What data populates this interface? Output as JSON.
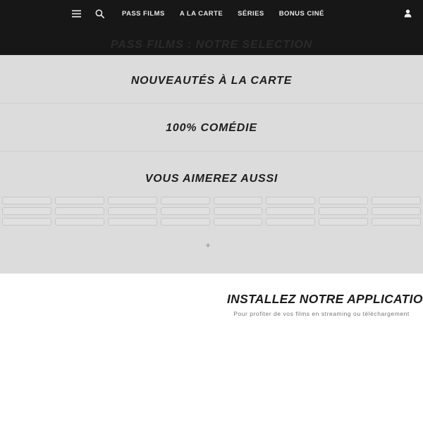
{
  "header": {
    "nav": {
      "menu_icon": "hamburger-menu-icon",
      "search_icon": "search-icon",
      "account_icon": "user-account-icon",
      "links": [
        {
          "label": "PASS FILMS"
        },
        {
          "label": "A LA CARTE"
        },
        {
          "label": "SÉRIES"
        },
        {
          "label": "BONUS CINÉ"
        }
      ]
    },
    "hero_title": "PASS FILMS : NOTRE SELECTION"
  },
  "sections": [
    {
      "title": "NOUVEAUTÉS À LA CARTE"
    },
    {
      "title": "100% COMÉDIE"
    },
    {
      "title": "VOUS AIMEREZ AUSSI"
    }
  ],
  "grid": {
    "columns": 8,
    "rows": 3,
    "cells": [
      "",
      "",
      "",
      "",
      "",
      "",
      "",
      "",
      "",
      "",
      "",
      "",
      "",
      "",
      "",
      "",
      "",
      "",
      "",
      "",
      "",
      "",
      "",
      ""
    ],
    "expand_label": "+",
    "expand_icon": "plus-icon"
  },
  "promo": {
    "title": "INSTALLEZ NOTRE APPLICATION",
    "subtitle": "Pour profiter de vos films en streaming ou téléchargement"
  },
  "colors": {
    "header_bg": "#171717",
    "body_bg": "#dcdcdc",
    "promo_bg": "#ffffff",
    "nav_text": "#e8e8e8",
    "heading_text": "#1e1e1e",
    "rule": "#cfcfcf",
    "card_fill": "#e0e0e0",
    "card_border": "#c6c6c6"
  }
}
